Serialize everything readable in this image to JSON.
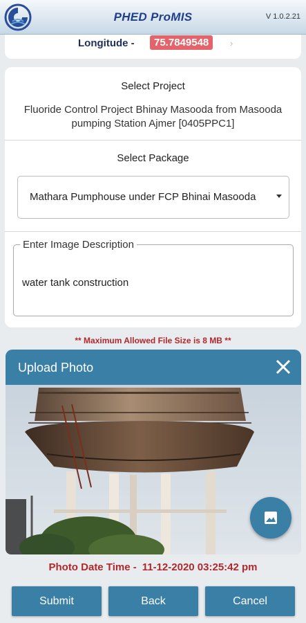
{
  "app": {
    "title": "PHED ProMIS",
    "version": "V 1.0.2.21",
    "logo_icon": "phed-logo-icon"
  },
  "location": {
    "longitude_label": "Longitude -",
    "longitude_value": "75.7849548"
  },
  "project": {
    "heading": "Select Project",
    "name": "Fluoride Control Project Bhinay Masooda from Masooda pumping Station Ajmer   [0405PPC1]"
  },
  "package": {
    "heading": "Select Package",
    "selected": "Mathara Pumphouse under FCP Bhinai Masooda"
  },
  "description": {
    "label": "Enter Image Description",
    "value": "water tank construction"
  },
  "notice": {
    "max_size": "** Maximum Allowed File Size is 8 MB **"
  },
  "upload": {
    "title": "Upload Photo",
    "close_icon": "close-icon",
    "gallery_icon": "image-icon",
    "date_label": "Photo Date Time -",
    "date_value": "11-12-2020 03:25:42 pm"
  },
  "actions": {
    "submit": "Submit",
    "back": "Back",
    "cancel": "Cancel"
  },
  "colors": {
    "accent": "#3a7fa6",
    "title_blue": "#1f3f8c",
    "alert_red": "#b0282d",
    "badge_red": "#e4646b"
  }
}
